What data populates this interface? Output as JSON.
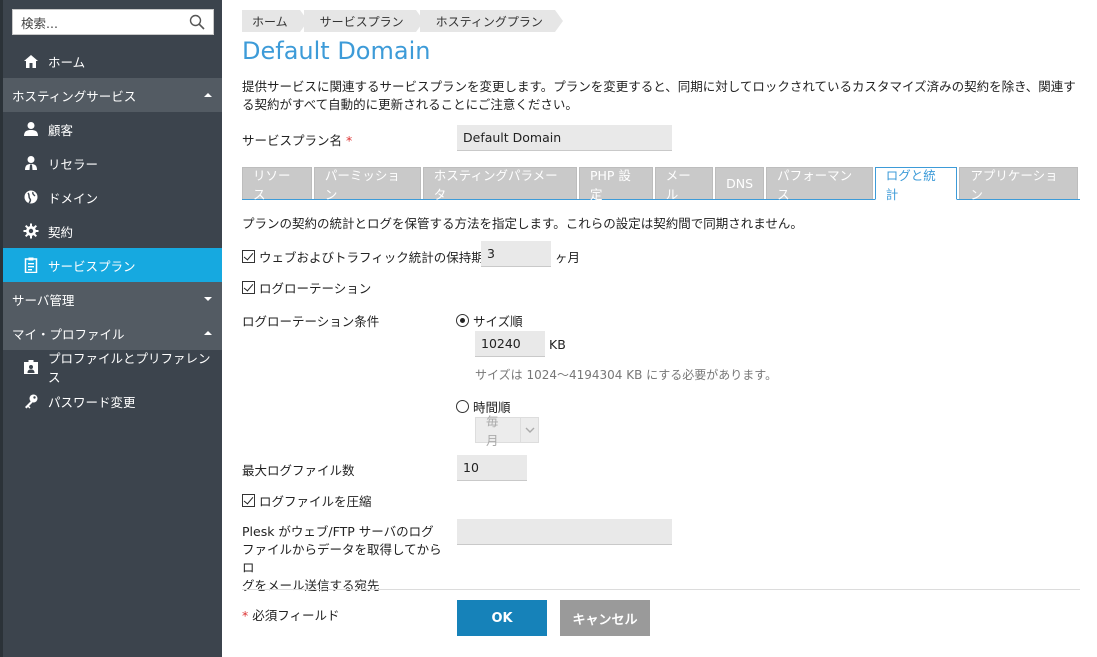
{
  "sidebar": {
    "search_placeholder": "検索...",
    "items": [
      {
        "label": "ホーム"
      },
      {
        "label": "ホスティングサービス"
      },
      {
        "label": "顧客"
      },
      {
        "label": "リセラー"
      },
      {
        "label": "ドメイン"
      },
      {
        "label": "契約"
      },
      {
        "label": "サービスプラン"
      },
      {
        "label": "サーバ管理"
      },
      {
        "label": "マイ・プロファイル"
      },
      {
        "label": "プロファイルとプリファレンス"
      },
      {
        "label": "パスワード変更"
      }
    ]
  },
  "breadcrumb": [
    "ホーム",
    "サービスプラン",
    "ホスティングプラン"
  ],
  "page_title": "Default Domain",
  "description": "提供サービスに関連するサービスプランを変更します。プランを変更すると、同期に対してロックされているカスタマイズ済みの契約を除き、関連する契約がすべて自動的に更新されることにご注意ください。",
  "form": {
    "plan_name_label": "サービスプラン名",
    "required_mark": "*",
    "plan_name_value": "Default Domain"
  },
  "tabs": [
    "リソース",
    "パーミッション",
    "ホスティングパラメータ",
    "PHP 設定",
    "メール",
    "DNS",
    "パフォーマンス",
    "ログと統計",
    "アプリケーション"
  ],
  "active_tab": "ログと統計",
  "section": {
    "intro": "プランの契約の統計とログを保管する方法を指定します。これらの設定は契約間で同期されません。",
    "retention_label": "ウェブおよびトラフィック統計の保持期間",
    "retention_value": "3",
    "retention_unit": "ヶ月",
    "log_rotation_label": "ログローテーション",
    "rotation_condition_label": "ログローテーション条件",
    "by_size_label": "サイズ順",
    "size_value": "10240",
    "size_unit": "KB",
    "size_hint": "サイズは 1024～4194304 KB にする必要があります。",
    "by_time_label": "時間順",
    "time_select_value": "毎月",
    "max_log_files_label": "最大ログファイル数",
    "max_log_files_value": "10",
    "compress_label": "ログファイルを圧縮",
    "email_label_1": "Plesk がウェブ/FTP サーバのログ",
    "email_label_2": "ファイルからデータを取得してからロ",
    "email_label_3": "グをメール送信する宛先",
    "email_value": ""
  },
  "footer": {
    "required_mark": "*",
    "required_note": "必須フィールド",
    "ok_label": "OK",
    "cancel_label": "キャンセル"
  },
  "colors": {
    "accent": "#3d9bd8",
    "sidebar_bg": "#3c444d",
    "active_nav": "#16a9e0",
    "ok_button": "#1682b9"
  }
}
